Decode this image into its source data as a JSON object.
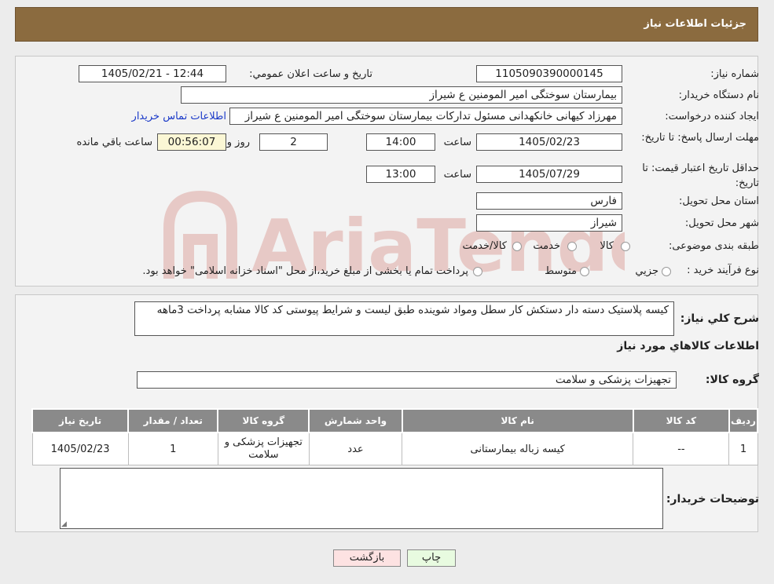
{
  "header": {
    "title": "جزئیات اطلاعات نیاز"
  },
  "form": {
    "need_number_label": "شماره نیاز:",
    "need_number": "1105090390000145",
    "announce_label": "تاریخ و ساعت اعلان عمومي:",
    "announce_value": "1405/02/21 - 12:44",
    "buyer_org_label": "نام دستگاه خريدار:",
    "buyer_org": "بیمارستان سوختگی امیر المومنین  ع  شیراز",
    "creator_label": "ايجاد کننده درخواست:",
    "creator": "مهرزاد کیهانی خانکهدانی مسئول تدارکات بیمارستان سوختگی امیر المومنین  ع  شیراز",
    "contact_link": "اطلاعات تماس خريدار",
    "deadline_label": "مهلت ارسال پاسخ: تا تاریخ:",
    "deadline_date": "1405/02/23",
    "time_label": "ساعت",
    "deadline_time": "14:00",
    "days": "2",
    "days_label": "روز و",
    "remaining": "00:56:07",
    "remaining_label": "ساعت باقي مانده",
    "validity_label": "حداقل تاريخ اعتبار قيمت: تا تاريخ:",
    "validity_date": "1405/07/29",
    "validity_time": "13:00",
    "province_label": "استان محل تحويل:",
    "province": "فارس",
    "city_label": "شهر محل تحويل:",
    "city": "شیراز",
    "category_label": "طبقه بندی موضوعی:",
    "category_options": [
      "کالا",
      "خدمت",
      "کالا/خدمت"
    ],
    "process_label": "نوع فرآيند خريد :",
    "process_options": [
      "جزيي",
      "متوسط"
    ],
    "process_note": "پرداخت تمام یا بخشی از مبلغ خرید،از محل \"اسناد خزانه اسلامی\" خواهد بود."
  },
  "description": {
    "label": "شرح کلي نياز:",
    "text": "کیسه پلاستیک دسته دار دستکش کار  سطل  ومواد شوینده  طبق لیست و شرایط پیوستی کد کالا مشابه پرداخت 3ماهه"
  },
  "goods": {
    "section_title": "اطلاعات کالاهاي مورد نياز",
    "group_label": "گروه کالا:",
    "group_value": "تجهیزات پزشکی و سلامت",
    "columns": [
      "رديف",
      "کد کالا",
      "نام کالا",
      "واحد شمارش",
      "گروه کالا",
      "تعداد / مقدار",
      "تاريخ نياز"
    ],
    "rows": [
      [
        "1",
        "--",
        "کیسه زباله بیمارستانی",
        "عدد",
        "تجهیزات پزشکی و سلامت",
        "1",
        "1405/02/23"
      ]
    ]
  },
  "buyer_notes": {
    "label": "توضيحات خريدار:",
    "text": ""
  },
  "buttons": {
    "print": "چاپ",
    "back": "بازگشت"
  },
  "watermark": {
    "text": "AriaTender.neT"
  },
  "colors": {
    "header": "#8b6b3f",
    "link": "#1a39c8",
    "table_header": "#8a8a8a",
    "print_btn": "#e8fbe0",
    "back_btn": "#fde2e2"
  }
}
